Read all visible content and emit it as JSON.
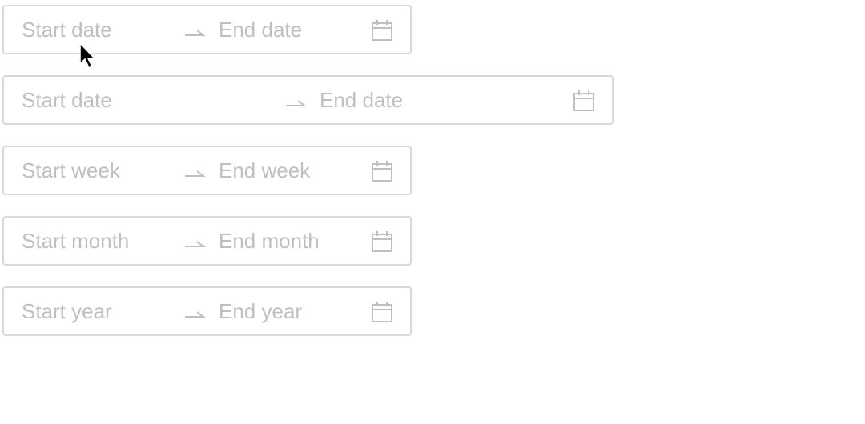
{
  "pickers": [
    {
      "start_placeholder": "Start date",
      "end_placeholder": "End date",
      "icon": "calendar-icon"
    },
    {
      "start_placeholder": "Start date",
      "end_placeholder": "End date",
      "icon": "calendar-icon"
    },
    {
      "start_placeholder": "Start week",
      "end_placeholder": "End week",
      "icon": "calendar-icon"
    },
    {
      "start_placeholder": "Start month",
      "end_placeholder": "End month",
      "icon": "calendar-icon"
    },
    {
      "start_placeholder": "Start year",
      "end_placeholder": "End year",
      "icon": "calendar-icon"
    }
  ],
  "colors": {
    "border": "#d9d9d9",
    "placeholder": "#bfbfbf",
    "icon": "#bfbfbf"
  }
}
